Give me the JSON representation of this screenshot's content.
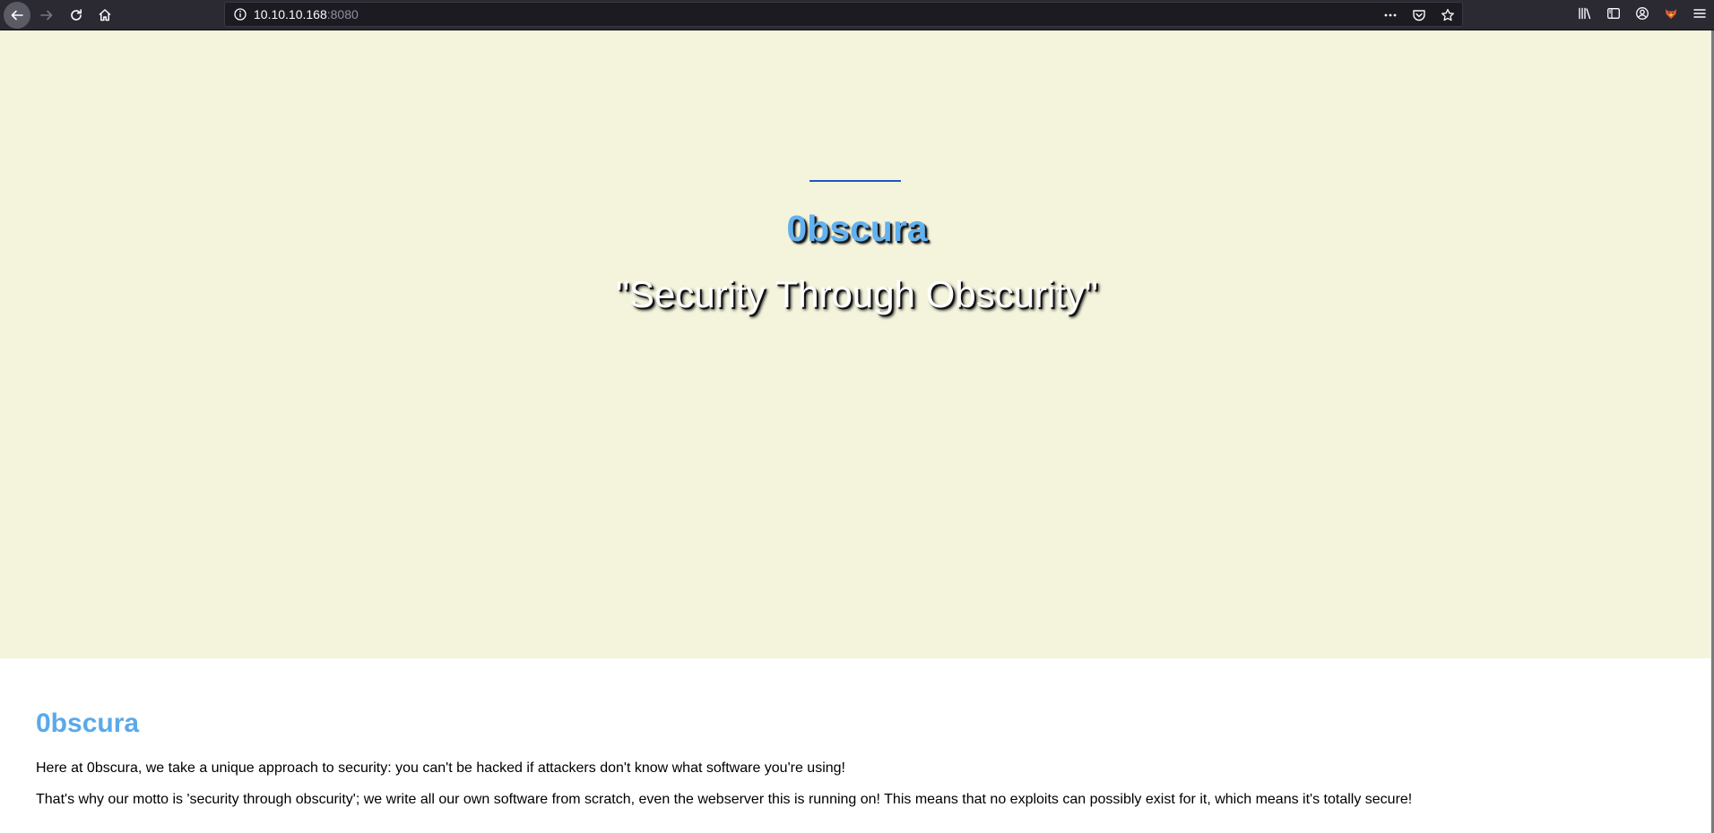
{
  "browser": {
    "url_host": "10.10.10.168",
    "url_port": ":8080",
    "icons": {
      "back": "back-arrow-icon",
      "forward": "forward-arrow-icon",
      "reload": "reload-icon",
      "home": "home-icon",
      "site_info": "info-icon",
      "page_actions": "more-icon",
      "pocket": "pocket-icon",
      "bookmark": "star-icon",
      "library": "library-icon",
      "sidebar": "sidebar-icon",
      "account": "account-icon",
      "extension": "fox-extension-icon",
      "menu": "hamburger-menu-icon"
    }
  },
  "hero": {
    "title": "0bscura",
    "motto": "\"Security Through Obscurity\""
  },
  "about": {
    "heading": "0bscura",
    "paragraph_1": "Here at 0bscura, we take a unique approach to security: you can't be hacked if attackers don't know what software you're using!",
    "paragraph_2": "That's why our motto is 'security through obscurity'; we write all our own software from scratch, even the webserver this is running on! This means that no exploits can possibly exist for it, which means it's totally secure!"
  },
  "colors": {
    "hero_background": "#f4f4dc",
    "title_blue": "#62b1f0",
    "heading_blue": "#5aa9ec",
    "rule_blue": "#1f56c4",
    "toolbar": "#2b2a33"
  }
}
